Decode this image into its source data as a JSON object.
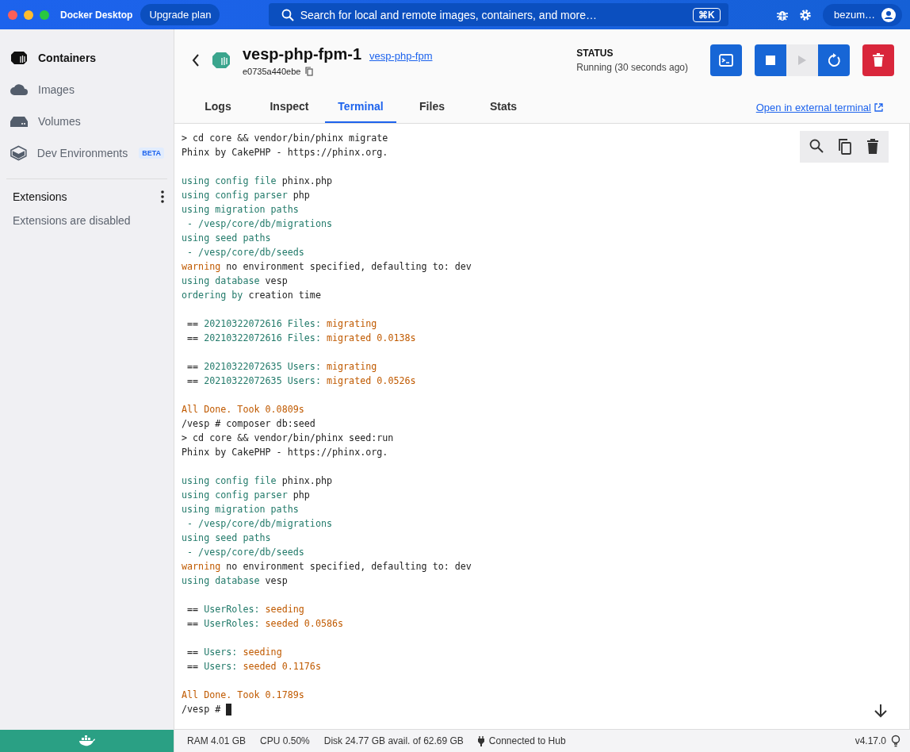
{
  "titlebar": {
    "app_title": "Docker Desktop",
    "upgrade_button": "Upgrade plan",
    "search_placeholder": "Search for local and remote images, containers, and more…",
    "shortcut": "⌘K",
    "user": "bezum…"
  },
  "sidebar": {
    "items": [
      {
        "label": "Containers",
        "kind": "containers",
        "selected": true
      },
      {
        "label": "Images",
        "kind": "images",
        "selected": false
      },
      {
        "label": "Volumes",
        "kind": "volumes",
        "selected": false
      },
      {
        "label": "Dev Environments",
        "kind": "dev",
        "selected": false,
        "badge": "BETA"
      }
    ],
    "extensions": {
      "title": "Extensions",
      "note": "Extensions are disabled"
    }
  },
  "container": {
    "name": "vesp-php-fpm-1",
    "image_link": "vesp-php-fpm",
    "id": "e0735a440ebe",
    "status_label": "STATUS",
    "status_value": "Running (30 seconds ago)"
  },
  "actions": [
    {
      "kind": "terminal",
      "disabled": false
    },
    {
      "kind": "stop",
      "disabled": false
    },
    {
      "kind": "start",
      "disabled": true
    },
    {
      "kind": "restart",
      "disabled": false
    },
    {
      "kind": "delete",
      "disabled": false
    }
  ],
  "tabs": [
    {
      "label": "Logs",
      "selected": false
    },
    {
      "label": "Inspect",
      "selected": false
    },
    {
      "label": "Terminal",
      "selected": true
    },
    {
      "label": "Files",
      "selected": false
    },
    {
      "label": "Stats",
      "selected": false
    }
  ],
  "external_link": "Open in external terminal",
  "terminal": {
    "cursor": true,
    "lines": [
      {
        "segments": [
          {
            "kind": "plain",
            "text": "> cd core && vendor/bin/phinx migrate"
          }
        ]
      },
      {
        "segments": [
          {
            "kind": "plain",
            "text": "Phinx by CakePHP - https://phinx.org."
          }
        ]
      },
      {
        "gap_before": true,
        "segments": [
          {
            "kind": "info",
            "text": "using config file"
          },
          {
            "kind": "plain",
            "text": " phinx.php"
          }
        ]
      },
      {
        "segments": [
          {
            "kind": "info",
            "text": "using config parser"
          },
          {
            "kind": "plain",
            "text": " php"
          }
        ]
      },
      {
        "segments": [
          {
            "kind": "info",
            "text": "using migration paths"
          }
        ]
      },
      {
        "segments": [
          {
            "kind": "info",
            "text": " - /vesp/core/db/migrations"
          }
        ]
      },
      {
        "segments": [
          {
            "kind": "info",
            "text": "using seed paths"
          }
        ]
      },
      {
        "segments": [
          {
            "kind": "info",
            "text": " - /vesp/core/db/seeds"
          }
        ]
      },
      {
        "segments": [
          {
            "kind": "warn",
            "text": "warning"
          },
          {
            "kind": "plain",
            "text": " no environment specified, defaulting to: dev"
          }
        ]
      },
      {
        "segments": [
          {
            "kind": "info",
            "text": "using database"
          },
          {
            "kind": "plain",
            "text": " vesp"
          }
        ]
      },
      {
        "segments": [
          {
            "kind": "info",
            "text": "ordering by"
          },
          {
            "kind": "plain",
            "text": " creation time"
          }
        ]
      },
      {
        "gap_before": true,
        "segments": [
          {
            "kind": "plain",
            "text": " == "
          },
          {
            "kind": "info",
            "text": "20210322072616 Files:"
          },
          {
            "kind": "warn",
            "text": " migrating"
          }
        ]
      },
      {
        "segments": [
          {
            "kind": "plain",
            "text": " == "
          },
          {
            "kind": "info",
            "text": "20210322072616 Files:"
          },
          {
            "kind": "warn",
            "text": " migrated 0.0138s"
          }
        ]
      },
      {
        "gap_before": true,
        "segments": [
          {
            "kind": "plain",
            "text": " == "
          },
          {
            "kind": "info",
            "text": "20210322072635 Users:"
          },
          {
            "kind": "warn",
            "text": " migrating"
          }
        ]
      },
      {
        "segments": [
          {
            "kind": "plain",
            "text": " == "
          },
          {
            "kind": "info",
            "text": "20210322072635 Users:"
          },
          {
            "kind": "warn",
            "text": " migrated 0.0526s"
          }
        ]
      },
      {
        "gap_before": true,
        "segments": [
          {
            "kind": "warn",
            "text": "All Done. Took 0.0809s"
          }
        ]
      },
      {
        "segments": [
          {
            "kind": "plain",
            "text": "/vesp # composer db:seed"
          }
        ]
      },
      {
        "segments": [
          {
            "kind": "plain",
            "text": "> cd core && vendor/bin/phinx seed:run"
          }
        ]
      },
      {
        "segments": [
          {
            "kind": "plain",
            "text": "Phinx by CakePHP - https://phinx.org."
          }
        ]
      },
      {
        "gap_before": true,
        "segments": [
          {
            "kind": "info",
            "text": "using config file"
          },
          {
            "kind": "plain",
            "text": " phinx.php"
          }
        ]
      },
      {
        "segments": [
          {
            "kind": "info",
            "text": "using config parser"
          },
          {
            "kind": "plain",
            "text": " php"
          }
        ]
      },
      {
        "segments": [
          {
            "kind": "info",
            "text": "using migration paths"
          }
        ]
      },
      {
        "segments": [
          {
            "kind": "info",
            "text": " - /vesp/core/db/migrations"
          }
        ]
      },
      {
        "segments": [
          {
            "kind": "info",
            "text": "using seed paths"
          }
        ]
      },
      {
        "segments": [
          {
            "kind": "info",
            "text": " - /vesp/core/db/seeds"
          }
        ]
      },
      {
        "segments": [
          {
            "kind": "warn",
            "text": "warning"
          },
          {
            "kind": "plain",
            "text": " no environment specified, defaulting to: dev"
          }
        ]
      },
      {
        "segments": [
          {
            "kind": "info",
            "text": "using database"
          },
          {
            "kind": "plain",
            "text": " vesp"
          }
        ]
      },
      {
        "gap_before": true,
        "segments": [
          {
            "kind": "plain",
            "text": " == "
          },
          {
            "kind": "info",
            "text": "UserRoles:"
          },
          {
            "kind": "warn",
            "text": " seeding"
          }
        ]
      },
      {
        "segments": [
          {
            "kind": "plain",
            "text": " == "
          },
          {
            "kind": "info",
            "text": "UserRoles:"
          },
          {
            "kind": "warn",
            "text": " seeded 0.0586s"
          }
        ]
      },
      {
        "gap_before": true,
        "segments": [
          {
            "kind": "plain",
            "text": " == "
          },
          {
            "kind": "info",
            "text": "Users:"
          },
          {
            "kind": "warn",
            "text": " seeding"
          }
        ]
      },
      {
        "segments": [
          {
            "kind": "plain",
            "text": " == "
          },
          {
            "kind": "info",
            "text": "Users:"
          },
          {
            "kind": "warn",
            "text": " seeded 0.1176s"
          }
        ]
      },
      {
        "gap_before": true,
        "segments": [
          {
            "kind": "warn",
            "text": "All Done. Took 0.1789s"
          }
        ]
      },
      {
        "segments": [
          {
            "kind": "plain",
            "text": "/vesp #"
          }
        ]
      }
    ]
  },
  "status_bar": {
    "ram": "RAM 4.01 GB",
    "cpu": "CPU 0.50%",
    "disk": "Disk 24.77 GB avail. of 62.69 GB",
    "hub": "Connected to Hub",
    "version": "v4.17.0"
  }
}
